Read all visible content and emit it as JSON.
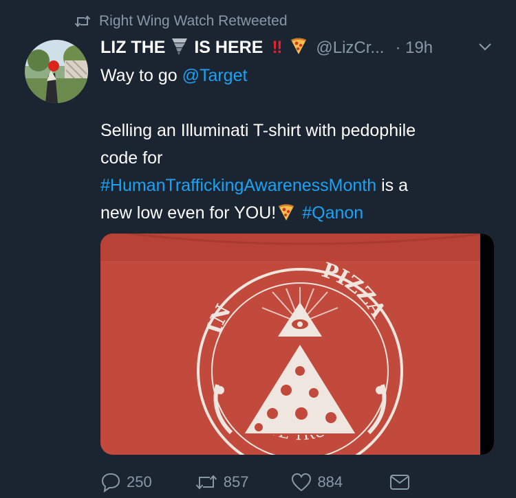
{
  "retweet": {
    "label": "Right Wing Watch Retweeted",
    "icon": "retweet-icon"
  },
  "tweet": {
    "author": {
      "name_part1": "LIZ THE",
      "name_part2": "IS HERE",
      "handle": "@LizCr...",
      "time": "· 19h"
    },
    "text": {
      "line1_prefix": "Way to go ",
      "mention": "@Target",
      "para2_line1": "Selling an Illuminati T-shirt with pedophile",
      "para2_line2": "code for",
      "hashtag1": "#HumanTraffickingAwarenessMonth",
      "after_hashtag1": " is a",
      "line_last": "new low even for YOU!",
      "hashtag2": "#Qanon"
    },
    "media": {
      "arc_top_left": "IN",
      "arc_top_right": "PIZZA",
      "arc_bottom": "WE TRUST"
    }
  },
  "actions": {
    "reply_count": "250",
    "retweet_count": "857",
    "like_count": "884"
  },
  "colors": {
    "background": "#1b2431",
    "muted": "#8899a6",
    "link": "#1da1f2",
    "shirt": "#c24a3c"
  }
}
